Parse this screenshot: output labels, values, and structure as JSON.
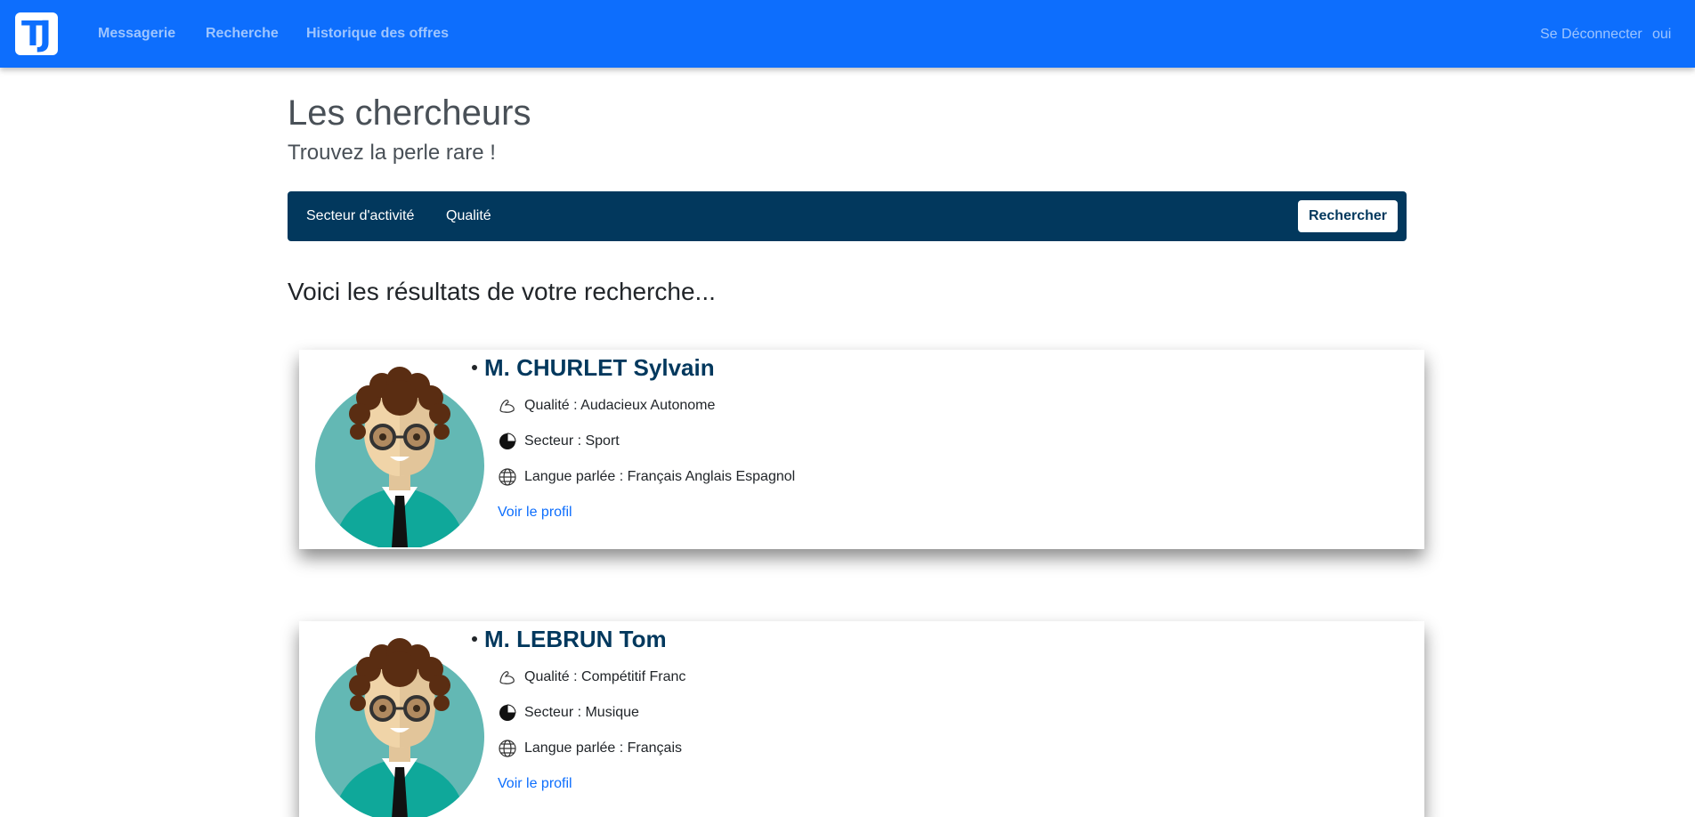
{
  "navbar": {
    "logo_text": "TJ",
    "links": [
      "Messagerie",
      "Recherche",
      "Historique des offres"
    ],
    "logout_label": "Se Déconnecter",
    "user_label": "oui"
  },
  "page": {
    "title": "Les chercheurs",
    "subtitle": "Trouvez la perle rare !"
  },
  "filters": {
    "items": [
      "Secteur d'activité",
      "Qualité"
    ],
    "search_label": "Rechercher"
  },
  "results": {
    "heading": "Voici les résultats de votre recherche...",
    "cards": [
      {
        "name": "M. CHURLET Sylvain",
        "quality": "Qualité : Audacieux Autonome",
        "sector": "Secteur : Sport",
        "languages": "Langue parlée : Français Anglais Espagnol",
        "link": "Voir le profil"
      },
      {
        "name": "M. LEBRUN Tom",
        "quality": "Qualité : Compétitif Franc",
        "sector": "Secteur : Musique",
        "languages": "Langue parlée : Français",
        "link": "Voir le profil"
      }
    ]
  },
  "icons": {
    "quality": "flexed-arm-icon",
    "sector": "pie-chart-icon",
    "languages": "globe-icon"
  },
  "colors": {
    "navbar": "#0d6efd",
    "navbar_link": "#9ec5fe",
    "filterbar": "#02385d",
    "name": "#02385d",
    "link": "#0d6efd"
  }
}
